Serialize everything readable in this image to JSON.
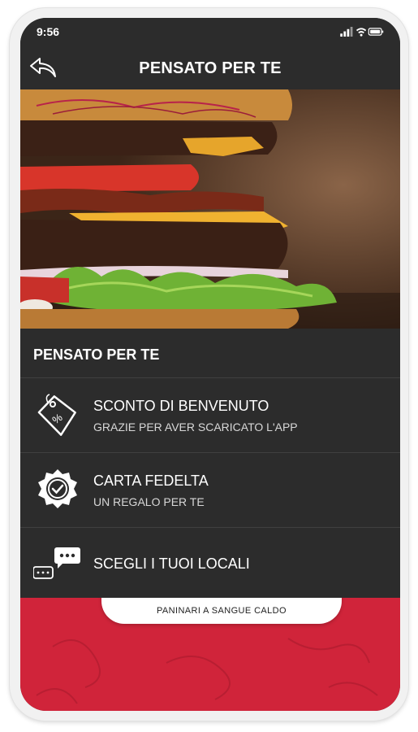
{
  "status_bar": {
    "time": "9:56"
  },
  "app_bar": {
    "title": "PENSATO PER TE"
  },
  "section": {
    "title": "PENSATO PER TE"
  },
  "menu": {
    "items": [
      {
        "icon": "discount-tag-icon",
        "title": "SCONTO DI BENVENUTO",
        "subtitle": "GRAZIE PER AVER SCARICATO L'APP"
      },
      {
        "icon": "badge-check-icon",
        "title": "CARTA FEDELTA",
        "subtitle": "UN REGALO PER TE"
      },
      {
        "icon": "chat-bubbles-icon",
        "title": "SCEGLI I TUOI LOCALI"
      }
    ]
  },
  "footer": {
    "tagline": "PANINARI A SANGUE CALDO"
  },
  "colors": {
    "dark": "#2c2c2c",
    "accent_red": "#d0243a",
    "text": "#ffffff"
  }
}
